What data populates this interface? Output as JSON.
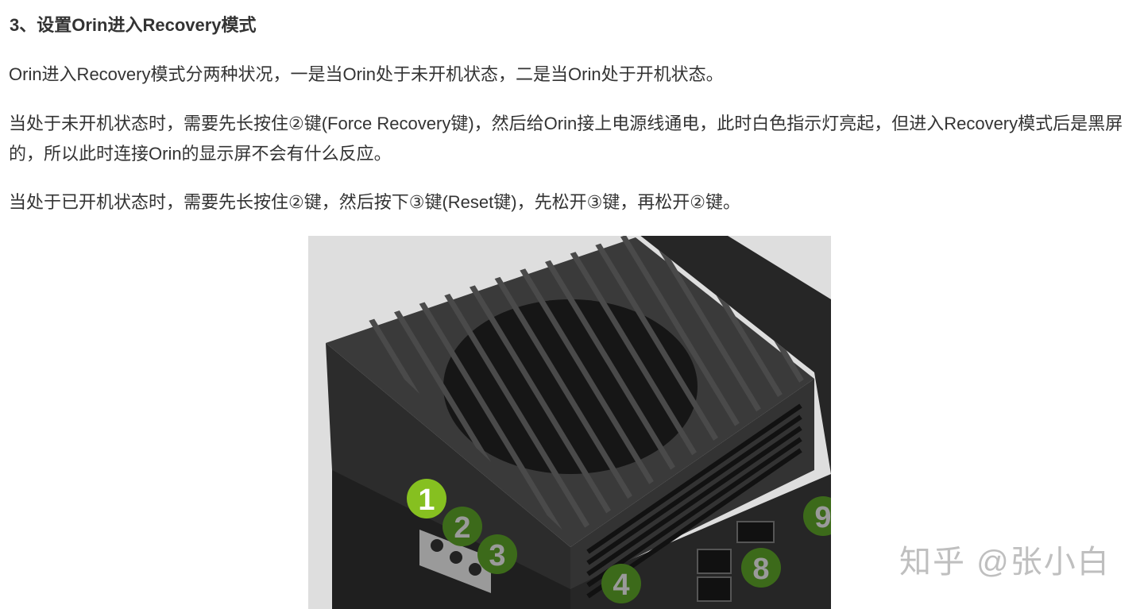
{
  "article": {
    "heading": "3、设置Orin进入Recovery模式",
    "paragraphs": [
      " Orin进入Recovery模式分两种状况，一是当Orin处于未开机状态，二是当Orin处于开机状态。",
      " 当处于未开机状态时，需要先长按住②键(Force Recovery键)，然后给Orin接上电源线通电，此时白色指示灯亮起，但进入Recovery模式后是黑屏的，所以此时连接Orin的显示屏不会有什么反应。",
      " 当处于已开机状态时，需要先长按住②键，然后按下③键(Reset键)，先松开③键，再松开②键。"
    ]
  },
  "figure": {
    "callouts": [
      "1",
      "2",
      "3",
      "4",
      "8",
      "9"
    ],
    "colors": {
      "background": "#dedede",
      "device": "#2a2a2a",
      "callout_active": "#86c020",
      "callout_dim": "#3c6a1a"
    }
  },
  "watermark": "知乎 @张小白"
}
